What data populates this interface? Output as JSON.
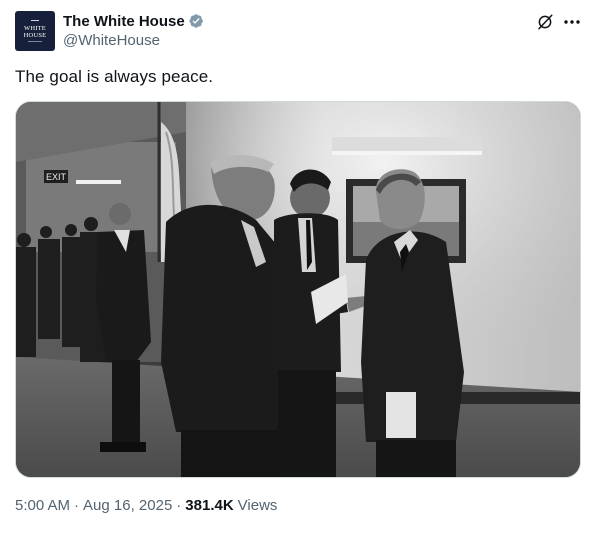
{
  "account": {
    "display_name": "The White House",
    "handle": "@WhiteHouse",
    "avatar_text_line1": "WHITE",
    "avatar_text_line2": "HOUSE",
    "verified_color": "#829aab"
  },
  "tweet": {
    "text": "The goal is always peace.",
    "time": "5:00 AM",
    "date": "Aug 16, 2025",
    "separator": "·",
    "views_count": "381.4K",
    "views_label": "Views"
  },
  "photo": {
    "exit_sign": "EXIT",
    "style": "black-and-white"
  },
  "icons": {
    "verified": "verified-badge-icon",
    "grok": "grok-icon",
    "more": "more-options-icon"
  },
  "colors": {
    "text_primary": "#0f1419",
    "text_secondary": "#536471",
    "border": "#cfd9de",
    "avatar_bg": "#17203a"
  }
}
